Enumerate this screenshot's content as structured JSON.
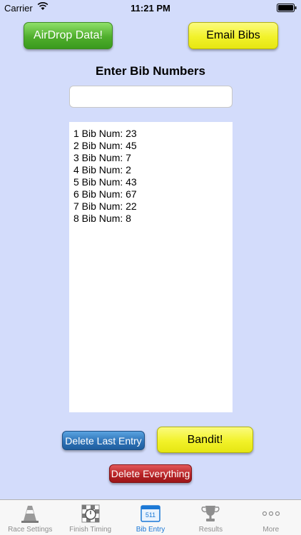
{
  "status_bar": {
    "carrier": "Carrier",
    "time": "11:21 PM"
  },
  "buttons": {
    "airdrop": "AirDrop Data!",
    "email": "Email Bibs",
    "delete_last": "Delete Last Entry",
    "bandit": "Bandit!",
    "delete_all": "Delete Everything"
  },
  "heading": "Enter Bib Numbers",
  "bib_input": {
    "value": "",
    "placeholder": ""
  },
  "entries": [
    "1 Bib Num: 23",
    "2 Bib Num: 45",
    "3 Bib Num: 7",
    "4 Bib Num: 2",
    "5 Bib Num: 43",
    "6 Bib Num: 67",
    "7 Bib Num: 22",
    "8 Bib Num: 8"
  ],
  "tabs": [
    {
      "label": "Race Settings",
      "icon": "cone-icon"
    },
    {
      "label": "Finish Timing",
      "icon": "checkered-stopwatch-icon"
    },
    {
      "label": "Bib Entry",
      "icon": "bib-icon",
      "badge": "511"
    },
    {
      "label": "Results",
      "icon": "trophy-icon"
    },
    {
      "label": "More",
      "icon": "more-icon"
    }
  ],
  "colors": {
    "background": "#d3dcfb",
    "active_tab": "#1b78d6",
    "inactive_tab": "#8e8e8e"
  }
}
